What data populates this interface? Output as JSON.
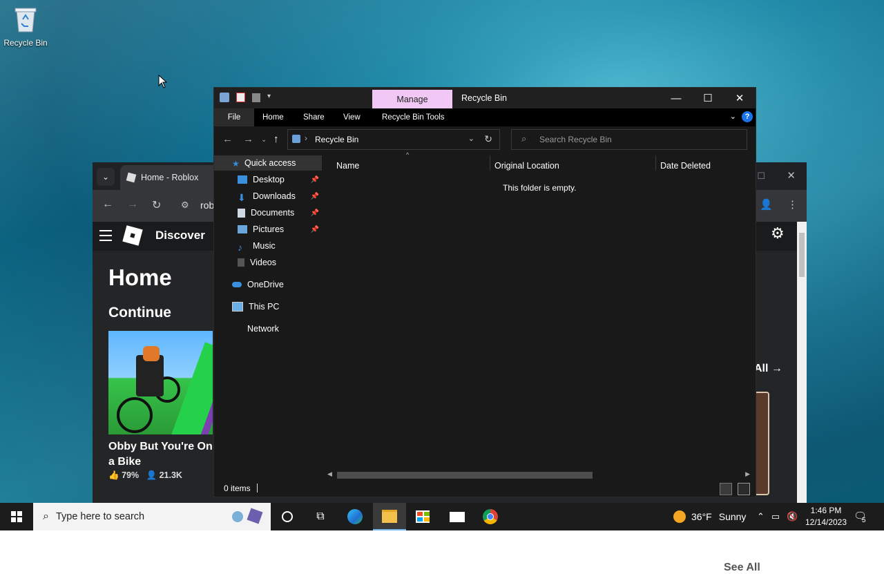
{
  "desktop": {
    "icons": [
      {
        "label": "Recycle Bin",
        "icon": "recycle-bin-icon"
      }
    ]
  },
  "chrome": {
    "tab_title": "Home - Roblox",
    "address_partial": "rob",
    "roblox": {
      "nav_title": "Discover",
      "page_heading": "Home",
      "section_heading": "Continue",
      "game_title": "Obby But You're On a Bike",
      "rating": "79%",
      "players": "21.3K",
      "see_all": "All",
      "see_all_bottom": "See All"
    }
  },
  "explorer": {
    "window_title": "Recycle Bin",
    "context_tab": "Manage",
    "ribbon_tabs": [
      "File",
      "Home",
      "Share",
      "View",
      "Recycle Bin Tools"
    ],
    "address": "Recycle Bin",
    "search_placeholder": "Search Recycle Bin",
    "nav": {
      "quick_access": "Quick access",
      "items": [
        {
          "label": "Desktop",
          "pinned": true
        },
        {
          "label": "Downloads",
          "pinned": true
        },
        {
          "label": "Documents",
          "pinned": true
        },
        {
          "label": "Pictures",
          "pinned": true
        },
        {
          "label": "Music",
          "pinned": false
        },
        {
          "label": "Videos",
          "pinned": false
        }
      ],
      "onedrive": "OneDrive",
      "this_pc": "This PC",
      "network": "Network"
    },
    "columns": [
      "Name",
      "Original Location",
      "Date Deleted"
    ],
    "empty_message": "This folder is empty.",
    "status_count": "0 items"
  },
  "taskbar": {
    "search_placeholder": "Type here to search",
    "weather_temp": "36°F",
    "weather_desc": "Sunny",
    "time": "1:46 PM",
    "date": "12/14/2023",
    "notification_count": "5"
  }
}
